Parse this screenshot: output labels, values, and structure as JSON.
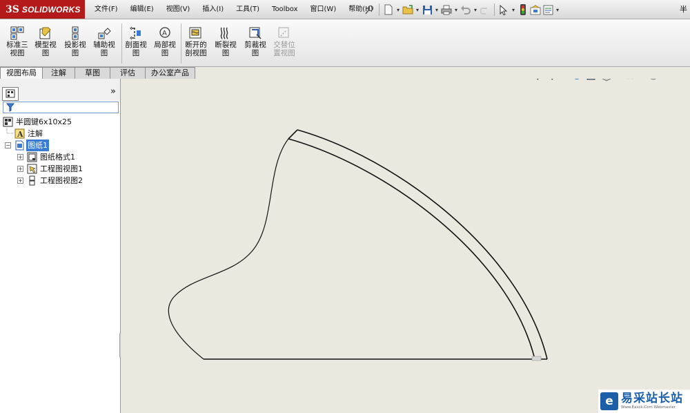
{
  "app": {
    "logo_ds": "3S",
    "logo_name": "SOLIDWORKS",
    "title_right": "半"
  },
  "menu": [
    "文件(F)",
    "编辑(E)",
    "视图(V)",
    "插入(I)",
    "工具(T)",
    "Toolbox",
    "窗口(W)",
    "帮助(H)"
  ],
  "quick_access_icons": [
    "pin-icon",
    "new-document-icon",
    "open-folder-icon",
    "save-icon",
    "print-icon",
    "undo-icon",
    "select-arrow-icon",
    "traffic-light-icon",
    "options-icon",
    "properties-icon"
  ],
  "commands": [
    {
      "label": "标准三\n视图",
      "icon": "standard-3-view-icon",
      "enabled": true
    },
    {
      "label": "模型视\n图",
      "icon": "model-view-icon",
      "enabled": true
    },
    {
      "label": "投影视\n图",
      "icon": "projected-view-icon",
      "enabled": true
    },
    {
      "label": "辅助视\n图",
      "icon": "auxiliary-view-icon",
      "enabled": true
    },
    {
      "label": "剖面视\n图",
      "icon": "section-view-icon",
      "enabled": true
    },
    {
      "label": "局部视\n图",
      "icon": "detail-view-icon",
      "enabled": true
    },
    {
      "label": "断开的\n剖视图",
      "icon": "broken-out-section-icon",
      "enabled": true
    },
    {
      "label": "断裂视\n图",
      "icon": "break-view-icon",
      "enabled": true
    },
    {
      "label": "剪裁视\n图",
      "icon": "crop-view-icon",
      "enabled": true
    },
    {
      "label": "交替位\n置视图",
      "icon": "alternate-position-view-icon",
      "enabled": false
    }
  ],
  "tabs": [
    {
      "label": "视图布局",
      "active": true
    },
    {
      "label": "注解",
      "active": false
    },
    {
      "label": "草图",
      "active": false
    },
    {
      "label": "评估",
      "active": false
    },
    {
      "label": "办公室产品",
      "active": false
    }
  ],
  "panel": {
    "collapse_label": "»",
    "tree": {
      "root": "半圆键6x10x25",
      "annotations": "注解",
      "sheet": "图纸1",
      "sheet_format": "图纸格式1",
      "view1": "工程图视图1",
      "view2": "工程图视图2"
    }
  },
  "watermark": {
    "main": "易采站长站",
    "sub": "Www.Easck.Com Webmaster"
  },
  "colors": {
    "logo_red": "#b41a1a",
    "selection_blue": "#3a7bd5",
    "canvas": "#eae8df"
  }
}
